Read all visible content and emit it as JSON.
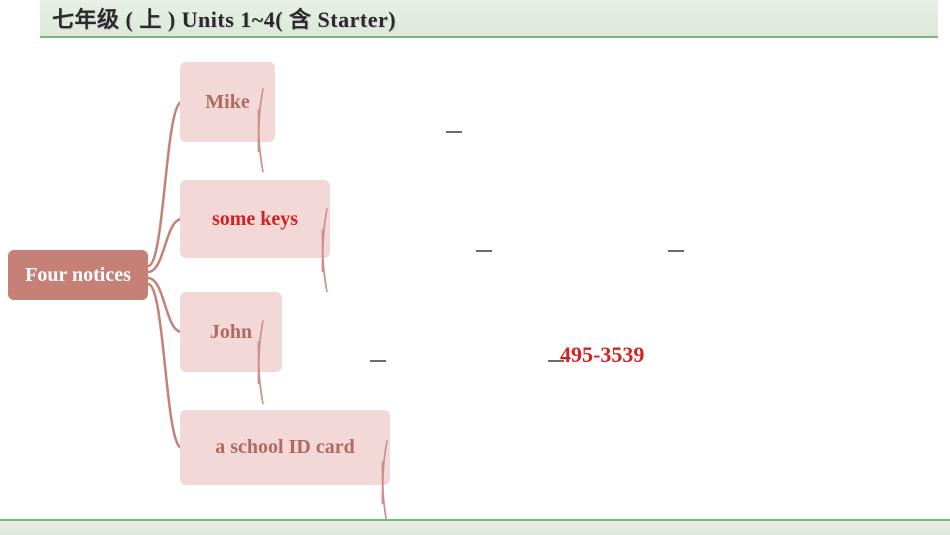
{
  "header": {
    "title": "七年级 ( 上 )  Units 1~4( 含 Starter)"
  },
  "root": {
    "label": "Four notices"
  },
  "children": [
    {
      "label": "Mike"
    },
    {
      "label": "some keys"
    },
    {
      "label": "John"
    },
    {
      "label": "a school ID card"
    }
  ],
  "detail": {
    "phone": "495-3539"
  },
  "chart_data": {
    "type": "tree",
    "title": "七年级 ( 上 ) Units 1~4( 含 Starter)",
    "root": "Four notices",
    "branches": [
      {
        "label": "Mike",
        "blanks": 1
      },
      {
        "label": "some keys",
        "highlighted": true,
        "blanks": 2
      },
      {
        "label": "John",
        "blanks": 2,
        "detail": "495-3539"
      },
      {
        "label": "a school ID card",
        "blanks": 0
      }
    ]
  }
}
